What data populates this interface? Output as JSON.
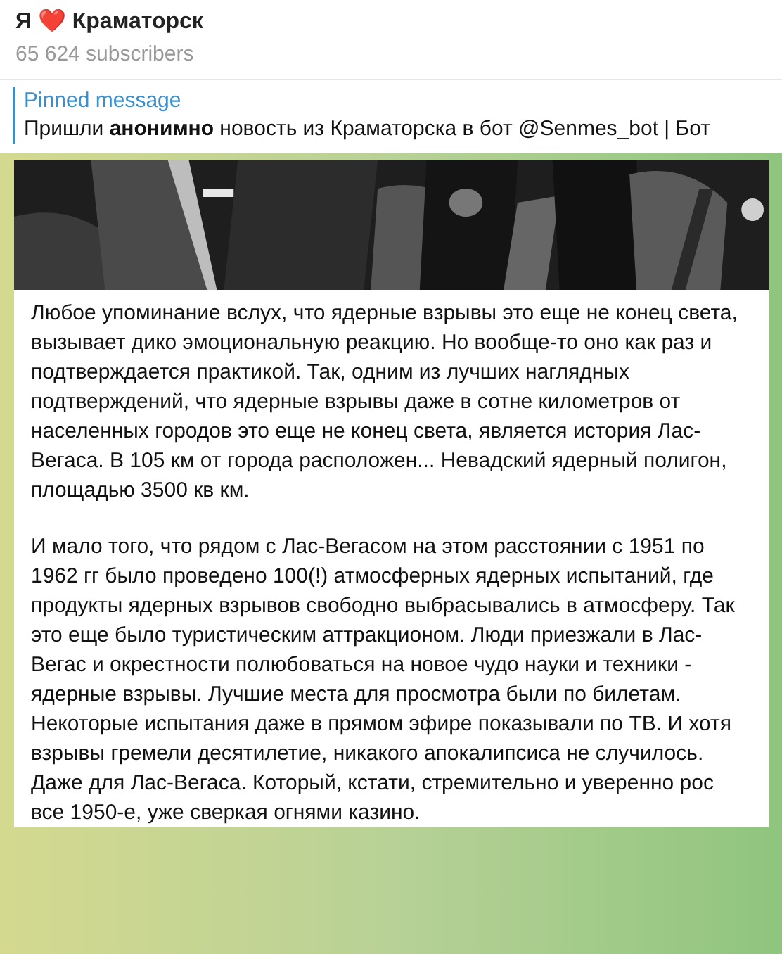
{
  "channel": {
    "title": "Я ❤️ Краматорск",
    "subscribers": "65 624 subscribers"
  },
  "pinned": {
    "label": "Pinned message",
    "text": "Пришли **анонимно** новость из Краматорска в бот @Senmes_bot | Бот"
  },
  "message": {
    "paragraphs": [
      "Любое упоминание вслух, что ядерные взрывы это еще не конец света, вызывает дико эмоциональную реакцию. Но вообще-то оно как раз и подтверждается практикой. Так, одним из лучших наглядных подтверждений, что ядерные взрывы даже в сотне километров от населенных городов это еще не конец света, является история Лас-Вегаса. В 105 км от города расположен... Невадский ядерный полигон, площадью 3500 кв км.",
      "И мало того, что рядом с Лас-Вегасом на этом расстоянии с 1951 по 1962 гг было проведено 100(!) атмосферных ядерных испытаний, где продукты ядерных взрывов свободно выбрасывались в атмосферу. Так это еще было туристическим аттракционом. Люди приезжали в Лас-Вегас и окрестности полюбоваться на новое чудо науки и техники - ядерные взрывы. Лучшие места для просмотра были по билетам. Некоторые испытания даже в прямом эфире показывали по ТВ. И хотя взрывы гремели десятилетие, никакого апокалипсиса не случилось. Даже для Лас-Вегаса. Который, кстати, стремительно и уверенно рос все 1950-е, уже сверкая огнями казино."
    ]
  }
}
